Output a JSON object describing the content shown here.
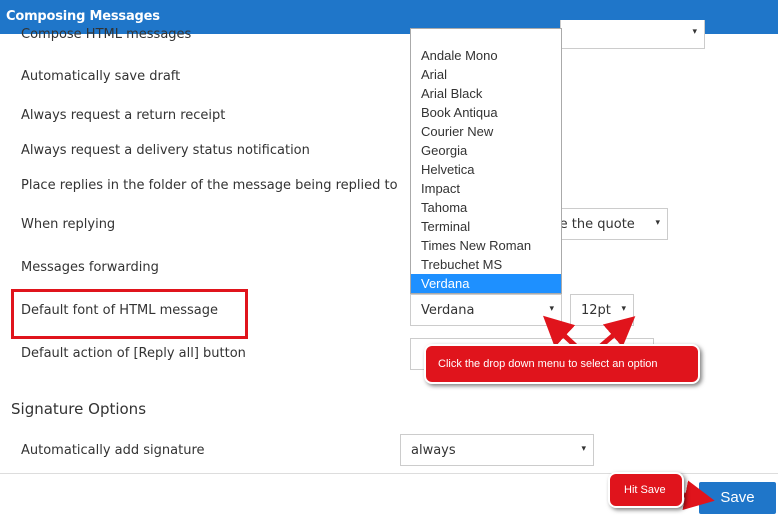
{
  "header": {
    "title": "Composing Messages"
  },
  "settings": {
    "rows": [
      "Compose HTML messages",
      "Automatically save draft",
      "Always request a return receipt",
      "Always request a delivery status notification",
      "Place replies in the folder of the message being replied to",
      "When replying",
      "Messages forwarding",
      "Default font of HTML message",
      "Default action of [Reply all] button"
    ],
    "when_replying_value": "ove the quote",
    "font_value": "Verdana",
    "size_value": "12pt"
  },
  "font_dropdown": {
    "options": [
      "Andale Mono",
      "Arial",
      "Arial Black",
      "Book Antiqua",
      "Courier New",
      "Georgia",
      "Helvetica",
      "Impact",
      "Tahoma",
      "Terminal",
      "Times New Roman",
      "Trebuchet MS",
      "Verdana"
    ],
    "selected": "Verdana"
  },
  "signature": {
    "heading": "Signature Options",
    "auto_label": "Automatically add signature",
    "auto_value": "always"
  },
  "annotations": {
    "dropdown_hint": "Click the drop down menu to select an option",
    "save_hint": "Hit Save"
  },
  "footer": {
    "save_label": "Save"
  },
  "icons": {
    "select_arrow": "chevron-down-icon"
  },
  "colors": {
    "header": "#1f76c9",
    "selected_option": "#1e90ff",
    "annotation_red": "#e0141c",
    "save_button": "#1f76c9"
  }
}
